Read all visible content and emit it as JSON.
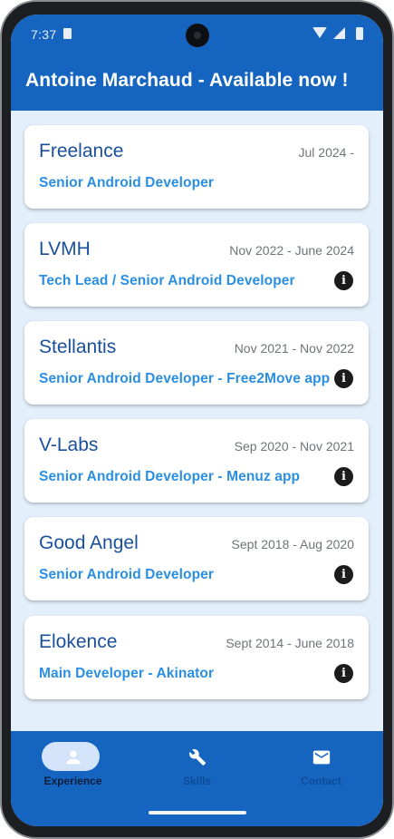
{
  "status_bar": {
    "time": "7:37"
  },
  "app_bar": {
    "title": "Antoine Marchaud - Available now !"
  },
  "experiences": [
    {
      "company": "Freelance",
      "dates": "Jul 2024 -",
      "role": "Senior Android Developer",
      "has_info": false
    },
    {
      "company": "LVMH",
      "dates": "Nov 2022 - June 2024",
      "role": "Tech Lead / Senior Android Developer",
      "has_info": true
    },
    {
      "company": "Stellantis",
      "dates": "Nov 2021 - Nov 2022",
      "role": "Senior Android Developer - Free2Move app",
      "has_info": true
    },
    {
      "company": "V-Labs",
      "dates": "Sep 2020 - Nov 2021",
      "role": "Senior Android Developer - Menuz app",
      "has_info": true
    },
    {
      "company": "Good Angel",
      "dates": "Sept 2018 - Aug 2020",
      "role": "Senior Android Developer",
      "has_info": true
    },
    {
      "company": "Elokence",
      "dates": "Sept 2014 - June 2018",
      "role": "Main Developer - Akinator",
      "has_info": true
    }
  ],
  "info_glyph": "i",
  "bottom_nav": {
    "items": [
      {
        "label": "Experience",
        "icon": "person-icon",
        "active": true
      },
      {
        "label": "Skills",
        "icon": "wrench-icon",
        "active": false
      },
      {
        "label": "Contact",
        "icon": "mail-icon",
        "active": false
      }
    ]
  },
  "colors": {
    "primary": "#1565c0",
    "background": "#e3f0fb",
    "company_text": "#1a4f9c",
    "role_text": "#2a8fe3",
    "active_pill": "#d3e4fa"
  }
}
